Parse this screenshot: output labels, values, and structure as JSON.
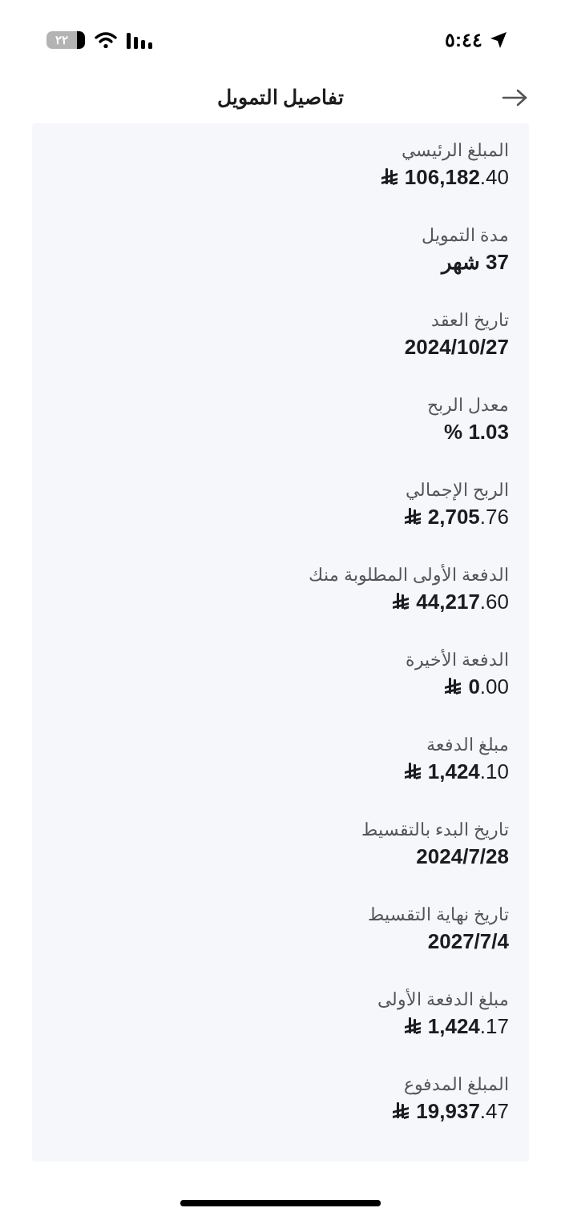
{
  "status_bar": {
    "time": "٥:٤٤",
    "battery": "٢٢"
  },
  "header": {
    "title": "تفاصيل التمويل"
  },
  "details": [
    {
      "label": "المبلغ الرئيسي",
      "value": "**106,182**.40",
      "kind": "money"
    },
    {
      "label": "مدة التمويل",
      "value": "37 شهر",
      "kind": "plain"
    },
    {
      "label": "تاريخ العقد",
      "value": "2024/10/27",
      "kind": "plain"
    },
    {
      "label": "معدل الربح",
      "value": "1.03 %",
      "kind": "plain"
    },
    {
      "label": "الربح الإجمالي",
      "value": "**2,705**.76",
      "kind": "money"
    },
    {
      "label": "الدفعة الأولى المطلوبة منك",
      "value": "**44,217**.60",
      "kind": "money"
    },
    {
      "label": "الدفعة الأخيرة",
      "value": "**0**.00",
      "kind": "money"
    },
    {
      "label": "مبلغ الدفعة",
      "value": "**1,424**.10",
      "kind": "money"
    },
    {
      "label": "تاريخ البدء بالتقسيط",
      "value": "2024/7/28",
      "kind": "plain"
    },
    {
      "label": "تاريخ نهاية التقسيط",
      "value": "2027/7/4",
      "kind": "plain"
    },
    {
      "label": "مبلغ الدفعة الأولى",
      "value": "**1,424**.17",
      "kind": "money"
    },
    {
      "label": "المبلغ المدفوع",
      "value": "**19,937**.47",
      "kind": "money"
    }
  ]
}
